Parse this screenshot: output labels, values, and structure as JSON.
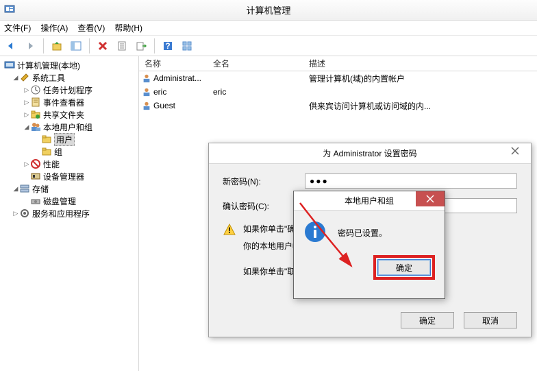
{
  "window": {
    "title": "计算机管理"
  },
  "menu": {
    "file": "文件(F)",
    "action": "操作(A)",
    "view": "查看(V)",
    "help": "帮助(H)"
  },
  "tree": {
    "root": "计算机管理(本地)",
    "sys_tools": "系统工具",
    "task_sched": "任务计划程序",
    "event_viewer": "事件查看器",
    "shared_folders": "共享文件夹",
    "local_users_groups": "本地用户和组",
    "users": "用户",
    "groups": "组",
    "performance": "性能",
    "device_mgr": "设备管理器",
    "storage": "存储",
    "disk_mgmt": "磁盘管理",
    "services_apps": "服务和应用程序"
  },
  "list": {
    "headers": {
      "name": "名称",
      "fullname": "全名",
      "desc": "描述"
    },
    "rows": [
      {
        "name": "Administrat...",
        "fullname": "",
        "desc": "管理计算机(域)的内置帐户"
      },
      {
        "name": "eric",
        "fullname": "eric",
        "desc": ""
      },
      {
        "name": "Guest",
        "fullname": "",
        "desc": "供来宾访问计算机或访问域的内..."
      }
    ]
  },
  "dialog1": {
    "title": "为 Administrator 设置密码",
    "new_pw_label": "新密码(N):",
    "new_pw_value": "●●●",
    "confirm_label": "确认密码(C):",
    "warn1_prefix": "如果你单击\"确定",
    "warn2": "你的本地用户帐                              。保存的密码和个人安全证书的访问",
    "warn3_prefix": "如果你单击\"取消\"，密                        据。",
    "ok": "确定",
    "cancel": "取消"
  },
  "dialog2": {
    "title": "本地用户和组",
    "message": "密码已设置。",
    "ok": "确定"
  }
}
